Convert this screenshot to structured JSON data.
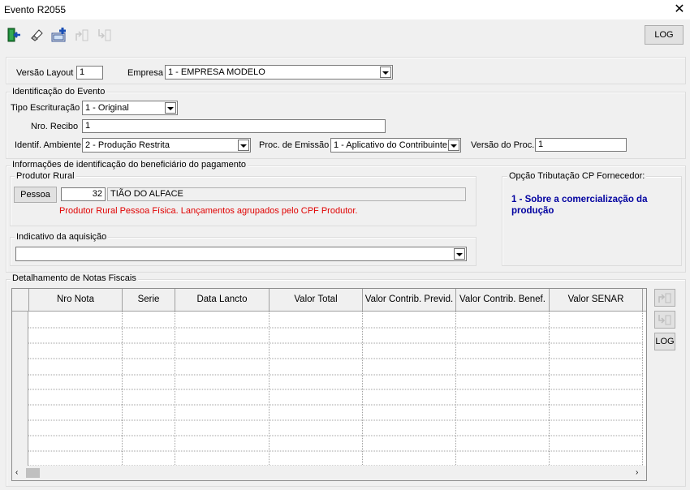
{
  "window": {
    "title": "Evento R2055",
    "close": "✕"
  },
  "toolbar": {
    "log_label": "LOG"
  },
  "layout": {
    "versao_label": "Versão Layout",
    "versao_value": "1",
    "empresa_label": "Empresa",
    "empresa_value": "1 - EMPRESA MODELO"
  },
  "identificacao": {
    "title": "Identificação do Evento",
    "tipo_label": "Tipo Escrituração",
    "tipo_value": "1 - Original",
    "recibo_label": "Nro. Recibo",
    "recibo_value": "1",
    "ambiente_label": "Identif. Ambiente",
    "ambiente_value": "2 - Produção Restrita",
    "proc_label": "Proc. de Emissão",
    "proc_value": "1 - Aplicativo do Contribuinte",
    "versao_proc_label": "Versão do Proc.",
    "versao_proc_value": "1"
  },
  "beneficiario": {
    "title": "Informações de identificação do beneficiário do pagamento",
    "produtor_title": "Produtor Rural",
    "pessoa_button": "Pessoa",
    "code": "32",
    "name": "TIÃO DO ALFACE",
    "message": "Produtor Rural Pessoa Física. Lançamentos agrupados pelo CPF Produtor.",
    "aquisicao_title": "Indicativo da aquisição",
    "aquisicao_value": "",
    "opcao_title": "Opção Tributação CP Fornecedor:",
    "opcao_value": "1 - Sobre a comercialização da produção"
  },
  "notas": {
    "title": "Detalhamento de Notas Fiscais",
    "columns": [
      "Nro Nota",
      "Serie",
      "Data Lancto",
      "Valor Total",
      "Valor Contrib. Previd.",
      "Valor Contrib. Benef.",
      "Valor SENAR"
    ],
    "log_label": "LOG"
  }
}
